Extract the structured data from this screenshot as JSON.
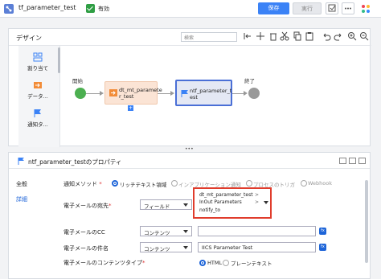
{
  "topbar": {
    "title": "tf_parameter_test",
    "valid_label": "有効",
    "save_label": "保存",
    "run_label": "実行"
  },
  "design": {
    "title": "デザイン",
    "search_placeholder": "検索",
    "palette": [
      {
        "label": "割り当て",
        "icon": "assignment-icon"
      },
      {
        "label": "データ...",
        "icon": "data-task-icon"
      },
      {
        "label": "通知タ...",
        "icon": "notify-flag-icon"
      }
    ],
    "nodes": {
      "start_label": "開始",
      "end_label": "終了",
      "param_line1": "dt_mt_paramete",
      "param_line2": "r_test",
      "notify_line1": "ntf_parameter_t",
      "notify_line2": "est"
    }
  },
  "properties": {
    "title": "ntf_parameter_testのプロパティ",
    "nav": {
      "general": "全般",
      "details": "詳細"
    },
    "notify_method": {
      "label": "通知メソッド",
      "options": [
        "リッチテキスト領域",
        "インアプリケーション通知",
        "プロセスのトリガ",
        "Webhook"
      ]
    },
    "email_to": {
      "label": "電子メールの宛先",
      "select_value": "フィールド",
      "dest_line1": "dt_mt_parameter_test",
      "dest_line2": "InOut Parameters",
      "dest_line3": "notify_to",
      "sep": ">"
    },
    "email_cc": {
      "label": "電子メールのCC",
      "select_value": "コンテンツ"
    },
    "email_subject": {
      "label": "電子メールの件名",
      "select_value": "コンテンツ",
      "value": "IICS Parameter Test"
    },
    "content_type": {
      "label": "電子メールのコンテンツタイプ",
      "options": [
        "HTML",
        "プレーンテキスト"
      ]
    },
    "fx_label": "fx"
  }
}
